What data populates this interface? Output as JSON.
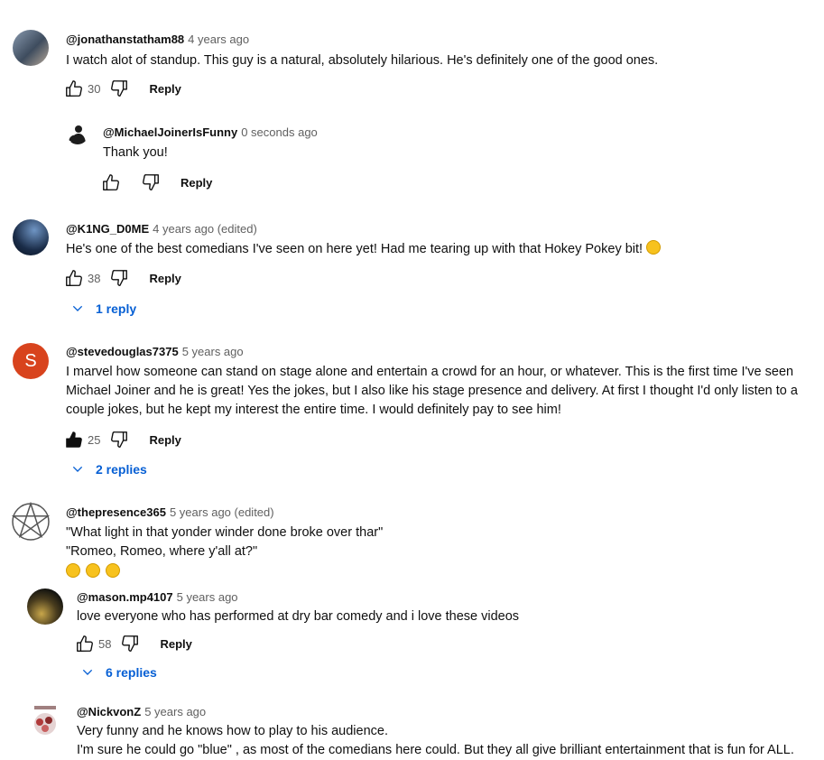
{
  "comments": [
    {
      "handle": "@jonathanstatham88",
      "time": "4 years ago",
      "text": "I watch alot of standup. This guy is a natural, absolutely hilarious. He's definitely one of the good ones.",
      "likes": "30",
      "reply_label": "Reply",
      "reply": {
        "handle": "@MichaelJoinerIsFunny",
        "time": "0 seconds ago",
        "text": "Thank you!",
        "reply_label": "Reply"
      }
    },
    {
      "handle": "@K1NG_D0ME",
      "time": "4 years ago (edited)",
      "text": "He's one of the best comedians I've seen on here yet! Had me tearing up with that Hokey Pokey bit!",
      "likes": "38",
      "reply_label": "Reply",
      "replies_toggle": "1 reply"
    },
    {
      "handle": "@stevedouglas7375",
      "time": "5 years ago",
      "avatar_letter": "S",
      "text_lines": [
        "I marvel how someone can stand on stage alone and entertain a crowd for an hour, or whatever. This is the first time I've seen",
        "Michael Joiner and he is great! Yes the jokes, but I also like his stage presence and delivery. At first I thought I'd only listen to a",
        "couple jokes, but he kept my interest the entire time. I would definitely pay to see him!"
      ],
      "likes": "25",
      "reply_label": "Reply",
      "replies_toggle": "2 replies"
    },
    {
      "handle": "@thepresence365",
      "time": "5 years ago (edited)",
      "text_lines": [
        "\"What light in that yonder winder done broke over thar\"",
        "\"Romeo, Romeo, where y'all at?\""
      ]
    },
    {
      "handle": "@mason.mp4107",
      "time": "5 years ago",
      "text": "love everyone who has performed at dry bar comedy and i love these videos",
      "likes": "58",
      "reply_label": "Reply",
      "replies_toggle": "6 replies"
    },
    {
      "handle": "@NickvonZ",
      "time": "5 years ago",
      "text_lines": [
        "Very funny and he knows how to play to his audience.",
        "I'm sure he could go \"blue\" , as most of the comedians here could. But they all give brilliant entertainment that is fun for ALL."
      ]
    }
  ],
  "colors": {
    "link_blue": "#065fd4",
    "avatar_s": "#d8431d",
    "meta_gray": "#606060"
  },
  "icons": [
    "thumbs-up-icon",
    "thumbs-down-icon",
    "chevron-down-icon",
    "laughing-emoji-icon",
    "pentagram-icon"
  ]
}
